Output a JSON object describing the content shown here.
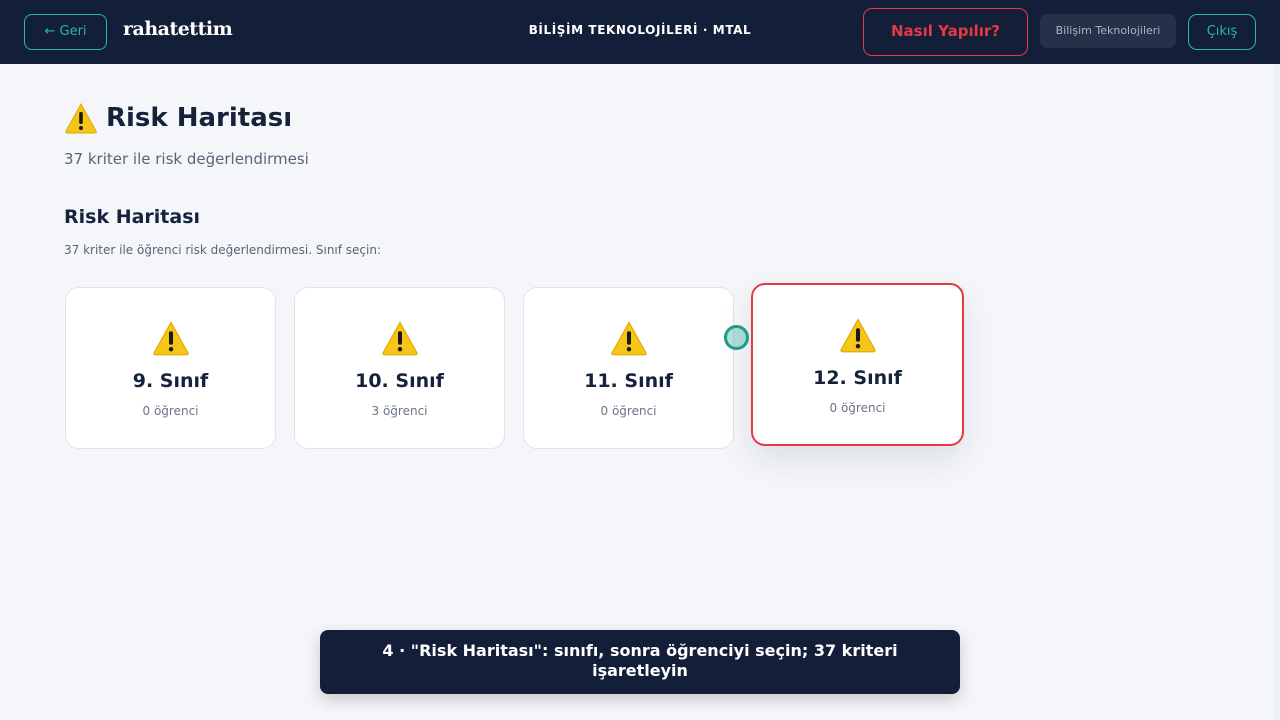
{
  "header": {
    "back_label": "← Geri",
    "logo": "rahatettim",
    "center_title": "BİLİŞİM TEKNOLOJİLERİ · MTAL",
    "howto_label": "Nasıl Yapılır?",
    "department": "Bilişim Teknolojileri",
    "logout_label": "Çıkış"
  },
  "page": {
    "title": "Risk Haritası",
    "subtitle": "37 kriter ile risk değerlendirmesi"
  },
  "section": {
    "title": "Risk Haritası",
    "description": "37 kriter ile öğrenci risk değerlendirmesi. Sınıf seçin:"
  },
  "cards": [
    {
      "grade": "9. Sınıf",
      "count": "0 öğrenci",
      "selected": false
    },
    {
      "grade": "10. Sınıf",
      "count": "3 öğrenci",
      "selected": false
    },
    {
      "grade": "11. Sınıf",
      "count": "0 öğrenci",
      "selected": false
    },
    {
      "grade": "12. Sınıf",
      "count": "0 öğrenci",
      "selected": true
    }
  ],
  "caption": "4 · \"Risk Haritası\": sınıfı, sonra öğrenciyi seçin; 37 kriteri işaretleyin",
  "colors": {
    "header_bg": "#131f38",
    "accent_teal": "#2bb5ad",
    "accent_red": "#e53a44",
    "page_bg": "#f4f6f9",
    "warning_yellow": "#f5c518"
  },
  "icons": {
    "warning": "warning-icon",
    "back_arrow": "arrow-left-icon"
  }
}
